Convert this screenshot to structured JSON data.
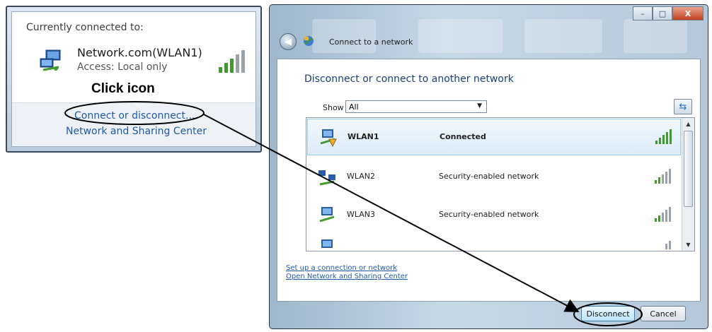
{
  "popup": {
    "title": "Currently connected to:",
    "network_name": "Network.com(WLAN1)",
    "access": "Access:  Local only",
    "annotation": "Click icon",
    "link_connect": "Connect or disconnect...",
    "link_center": "Network and Sharing Center"
  },
  "dialog": {
    "title": "Connect to a network",
    "heading": "Disconnect or connect to another network",
    "show_label": "Show",
    "show_value": "All",
    "networks": [
      {
        "name": "WLAN1",
        "status": "Connected",
        "selected": true
      },
      {
        "name": "WLAN2",
        "status": "Security-enabled network",
        "selected": false
      },
      {
        "name": "WLAN3",
        "status": "Security-enabled network",
        "selected": false
      }
    ],
    "link_setup": "Set up a connection or network",
    "link_open": "Open Network and Sharing Center",
    "disconnect_label": "Disconnect",
    "cancel_label": "Cancel"
  },
  "colors": {
    "link": "#1f5aa6",
    "signal_green": "#3e9b2c",
    "selection": "#dcebf8"
  }
}
